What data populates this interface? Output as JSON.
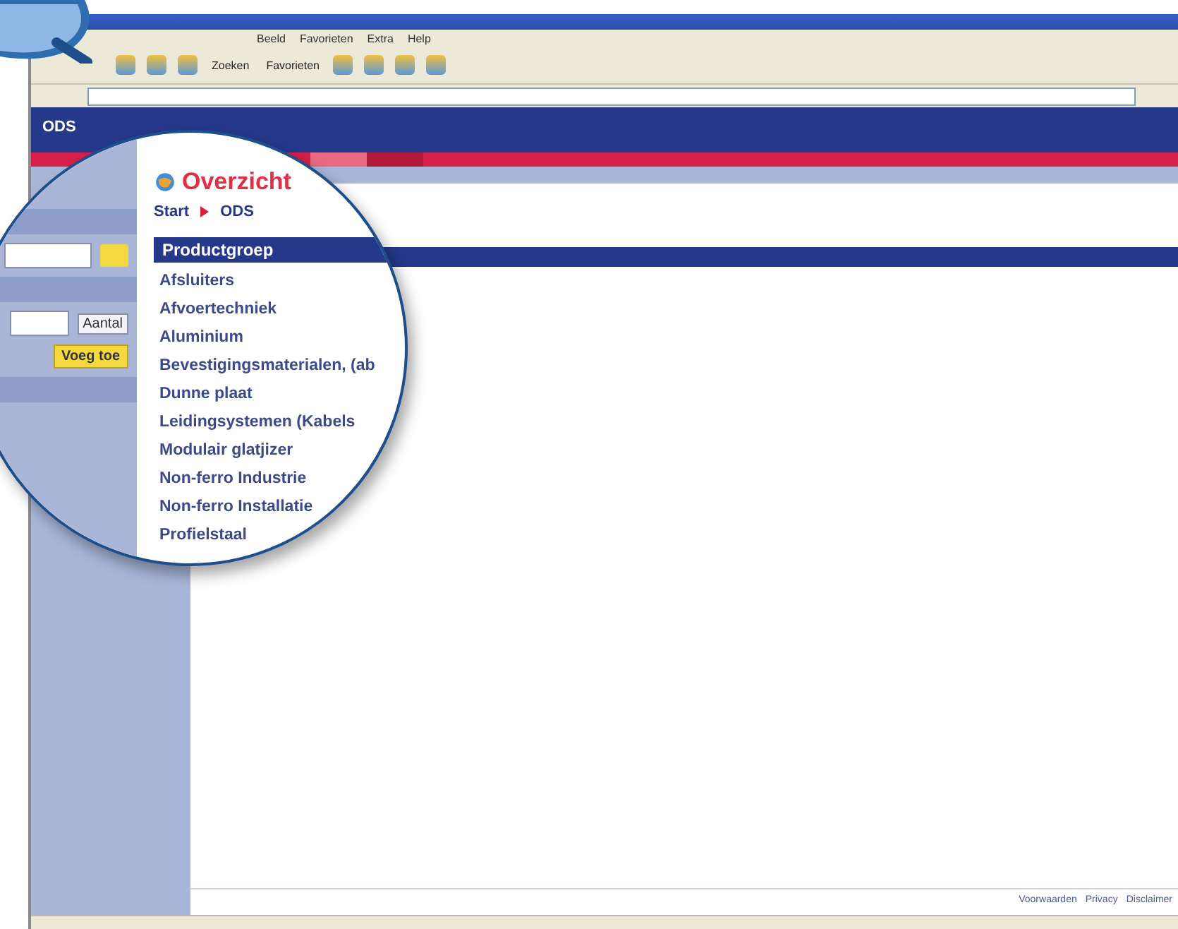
{
  "browser": {
    "menu": [
      "Beeld",
      "Favorieten",
      "Extra",
      "Help"
    ],
    "toolbar": [
      "Zoeken",
      "Favorieten"
    ]
  },
  "site": {
    "logo": "ODS",
    "nav_tabs": [
      {
        "selected": true
      },
      {
        "selected": false
      }
    ]
  },
  "magnifier": {
    "title": "Overzicht",
    "breadcrumb": [
      "Start",
      "ODS"
    ],
    "field_label": "Aantal",
    "add_button": "Voeg toe",
    "list_header": "Productgroep",
    "items": [
      "Afsluiters",
      "Afvoertechniek",
      "Aluminium",
      "Bevestigingsmaterialen, (ab",
      "Dunne plaat",
      "Leidingsystemen (Kabels",
      "Modulair glatjizer",
      "Non-ferro Industrie",
      "Non-ferro Installatie",
      "Profielstaal"
    ]
  },
  "footer": {
    "links": [
      "Voorwaarden",
      "Privacy",
      "Disclaimer"
    ]
  }
}
